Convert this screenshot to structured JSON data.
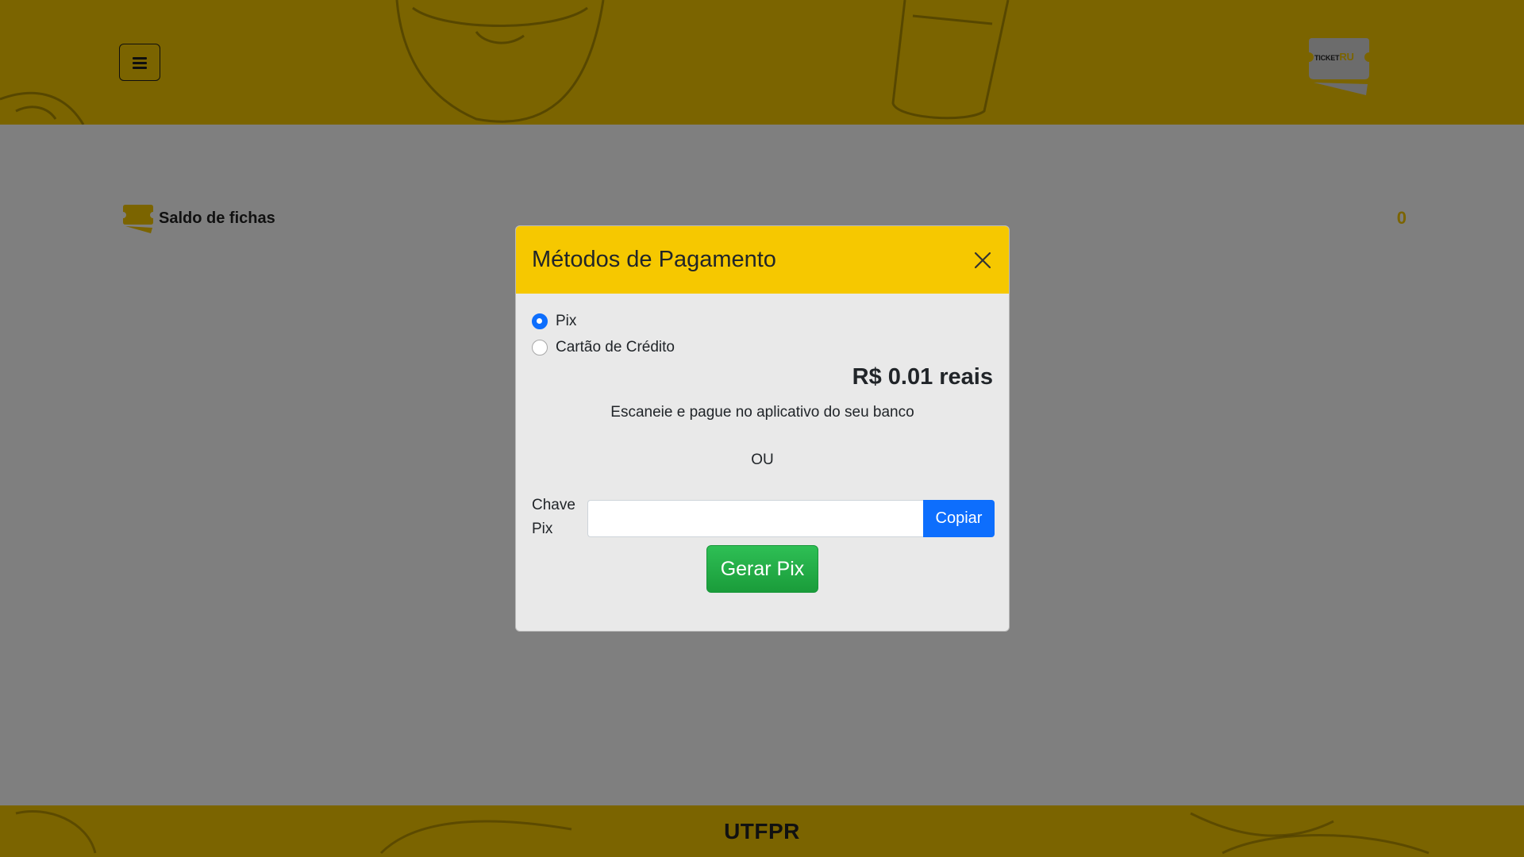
{
  "header": {
    "menu_icon": "hamburger-icon",
    "logo": {
      "ticket": "TICKET",
      "ru": "RU"
    }
  },
  "main": {
    "balance": {
      "icon": "ticket-icon",
      "label": "Saldo de fichas",
      "value": "0"
    }
  },
  "footer": {
    "text": "UTFPR"
  },
  "modal": {
    "title": "Métodos de Pagamento",
    "close_icon": "close-icon",
    "payment_options": [
      {
        "label": "Pix",
        "checked": true
      },
      {
        "label": "Cartão de Crédito",
        "checked": false
      }
    ],
    "price": "R$ 0.01 reais",
    "scan_instruction": "Escaneie e pague no aplicativo do seu banco",
    "or_text": "OU",
    "pix_key_label": "Chave Pix",
    "pix_key_value": "",
    "copy_label": "Copiar",
    "generate_label": "Gerar Pix"
  },
  "colors": {
    "brand_yellow": "#f6c800",
    "primary_blue": "#0d6efd",
    "success_green": "#1fa746"
  }
}
